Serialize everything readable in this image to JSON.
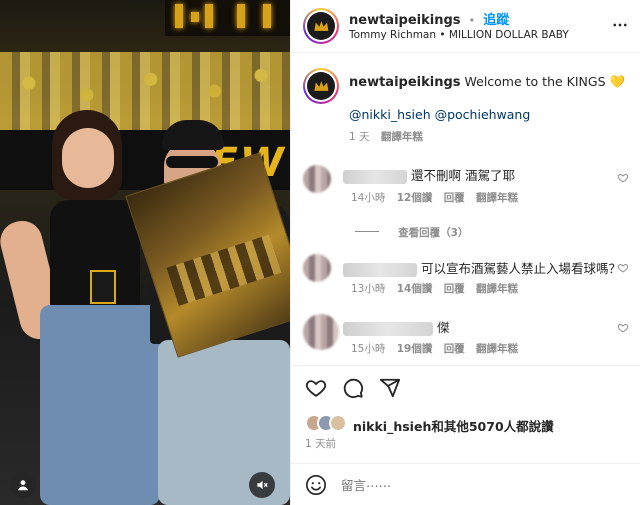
{
  "post": {
    "account": "newtaipeikings",
    "follow_label": "追蹤",
    "separator": "•",
    "music": "Tommy Richman • MILLION DOLLAR BABY",
    "caption_text": "Welcome to the KINGS",
    "caption_emoji": "💛",
    "mentions": "@nikki_hsieh @pochiehwang",
    "time": "1 天",
    "translate": "翻譯年糕",
    "photo_banner": "NEW T"
  },
  "comments": [
    {
      "text": "還不刪啊 酒駕了耶",
      "time": "14小時",
      "likes": "12個讚",
      "reply": "回覆",
      "translate": "翻譯年糕"
    },
    {
      "text": "可以宣布酒駕藝人禁止入場看球嗎？",
      "time": "13小時",
      "likes": "14個讚",
      "reply": "回覆",
      "translate": "翻譯年糕"
    },
    {
      "text": "傑",
      "time": "15小時",
      "likes": "19個讚",
      "reply": "回覆",
      "translate": "翻譯年糕"
    }
  ],
  "view_replies": "查看回覆（3）",
  "likes_summary": {
    "user": "nikki_hsieh",
    "rest": "和其他5070人都說讚"
  },
  "post_age": "1 天前",
  "composer": {
    "placeholder": "留言⋯⋯"
  },
  "colors": {
    "accent": "#0095f6",
    "emoji_yellow": "#f7c600",
    "brand_gold": "#d8a11a"
  },
  "icons": [
    "more-icon",
    "heart-icon",
    "comment-icon",
    "share-icon",
    "emoji-icon",
    "user-tag-icon",
    "mute-icon"
  ]
}
